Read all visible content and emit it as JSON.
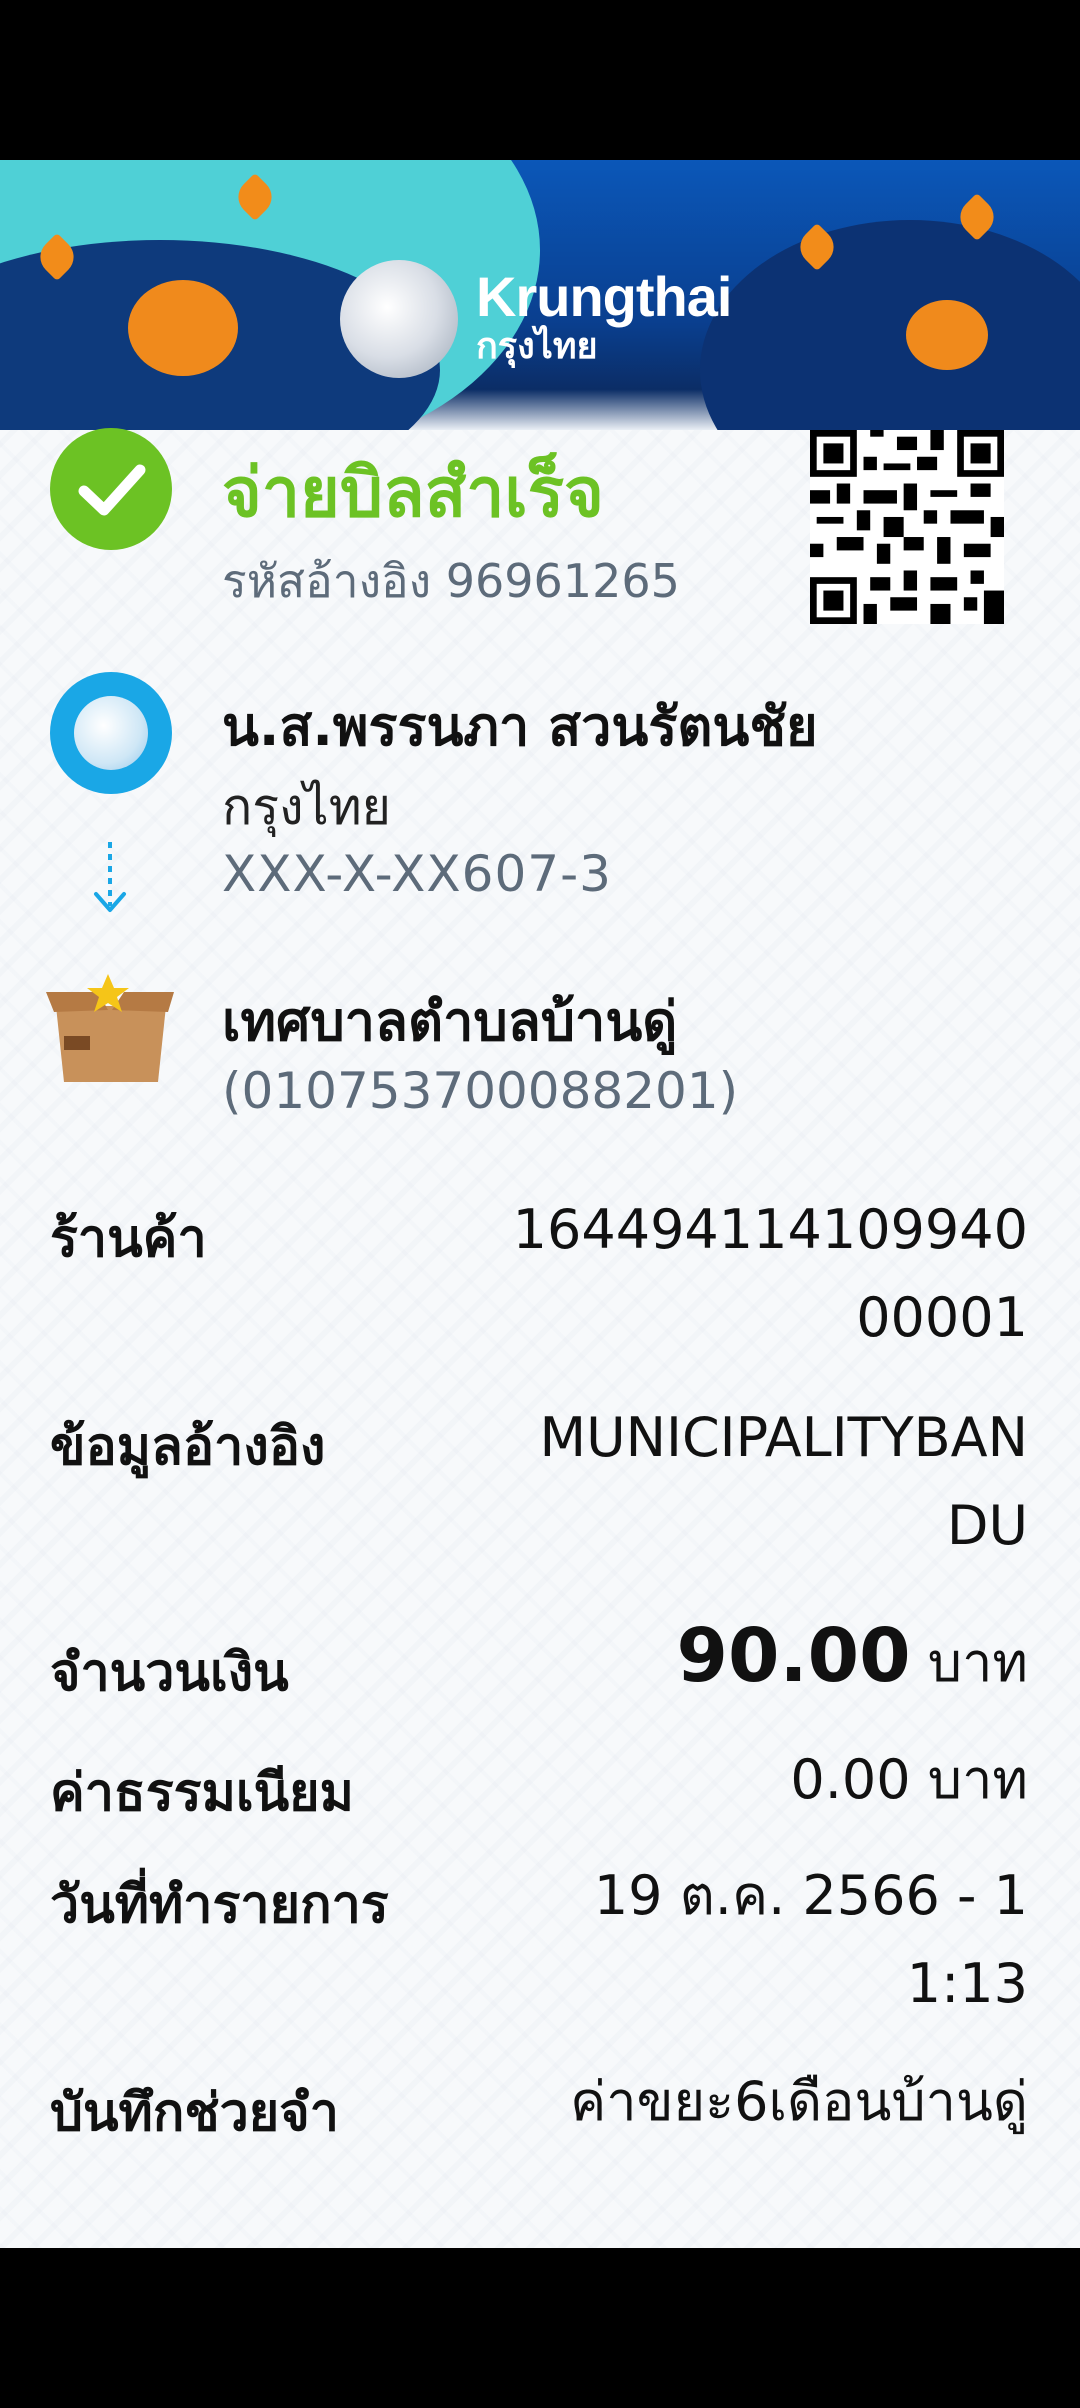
{
  "bank": {
    "name_en": "Krungthai",
    "name_th": "กรุงไทย"
  },
  "status": {
    "title": "จ่ายบิลสำเร็จ",
    "reference": "รหัสอ้างอิง 96961265"
  },
  "sender": {
    "name": "น.ส.พรรนภา สวนรัตนชัย",
    "bank": "กรุงไทย",
    "account": "XXX-X-XX607-3"
  },
  "payee": {
    "name": "เทศบาลตำบลบ้านดู่",
    "biller_id": "(010753700088201)"
  },
  "details": {
    "merchant": {
      "label": "ร้านค้า",
      "value": "16449411410994000001"
    },
    "reference_info": {
      "label": "ข้อมูลอ้างอิง",
      "value": "MUNICIPALITYBANDU"
    },
    "amount": {
      "label": "จำนวนเงิน",
      "value": "90.00",
      "unit": "บาท"
    },
    "fee": {
      "label": "ค่าธรรมเนียม",
      "value": "0.00 บาท"
    },
    "date": {
      "label": "วันที่ทำรายการ",
      "value": "19 ต.ค. 2566 - 11:13"
    },
    "memo": {
      "label": "บันทึกช่วยจำ",
      "value": "ค่าขยะ6เดือนบ้านดู่"
    }
  },
  "colors": {
    "success": "#6cc224",
    "brand": "#1aa7e6",
    "banner": "#0b57b8"
  }
}
